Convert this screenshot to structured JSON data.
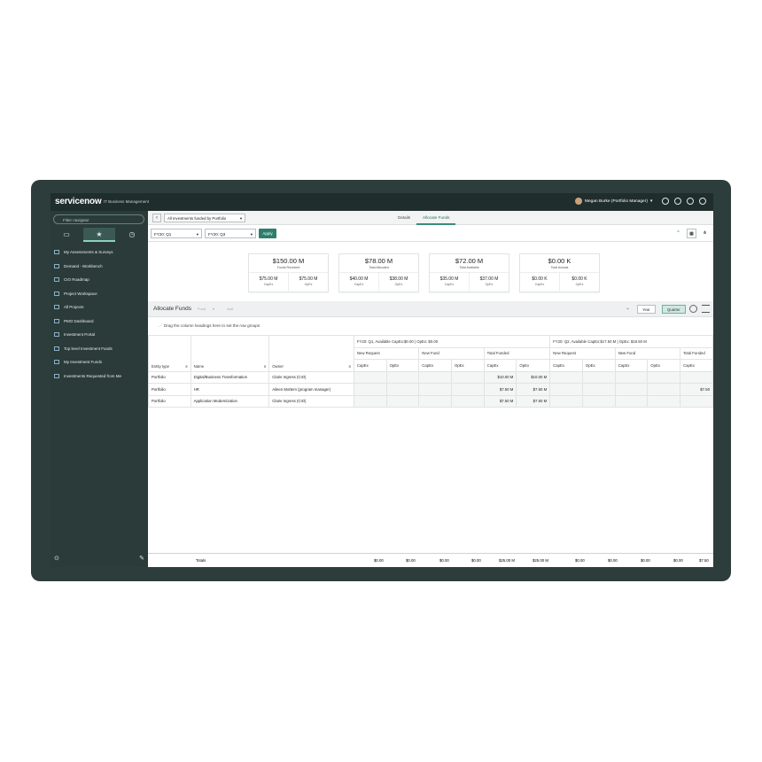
{
  "app": {
    "logo": "servicenow",
    "logo_sub": "IT Business Management",
    "user": "Megan Burke (Portfolio Manager)"
  },
  "sidebar": {
    "filter_placeholder": "Filter navigator",
    "items": [
      {
        "label": "My Assessments & Surveys"
      },
      {
        "label": "Demand - Workbench"
      },
      {
        "label": "CIO Roadmap"
      },
      {
        "label": "Project Workspace"
      },
      {
        "label": "All Projects"
      },
      {
        "label": "PMO Dashboard"
      },
      {
        "label": "Investment Portal"
      },
      {
        "label": "Top level Investment Funds"
      },
      {
        "label": "My Investment Funds"
      },
      {
        "label": "Investments Requested from Me"
      }
    ]
  },
  "header": {
    "portfolio_select": "All Investments funded by Portfolio",
    "tabs": [
      "Details",
      "Allocate Funds"
    ]
  },
  "filters": {
    "from": "FY20: Q1",
    "to": "FY20: Q3",
    "apply": "Apply"
  },
  "cards": [
    {
      "value": "$150.00 M",
      "label": "Funds Received",
      "capex": "$75.00 M",
      "opex": "$75.00 M"
    },
    {
      "value": "$78.00 M",
      "label": "Total Allocated",
      "capex": "$40.00 M",
      "opex": "$38.00 M"
    },
    {
      "value": "$72.00 M",
      "label": "Total Available",
      "capex": "$35.00 M",
      "opex": "$37.00 M"
    },
    {
      "value": "$0.00 K",
      "label": "Total Actuals",
      "capex": "$0.00 K",
      "opex": "$0.00 K"
    }
  ],
  "card_sub_labels": {
    "capex": "CapEx",
    "opex": "OpEx"
  },
  "allocate": {
    "title": "Allocate Funds",
    "fund_btn": "Fund",
    "add_btn": "Add",
    "year": "Year",
    "quarter": "Quarter",
    "group_hint": "Drag the column headings here to set the row groups"
  },
  "grid": {
    "q1_header": "FY20: Q1, Available CapEx:$0.00 | OpEx: $0.00",
    "q2_header": "FY20: Q2, Available CapEx:$17.50 M | OpEx: $18.50 M",
    "groups": [
      "New Request",
      "New Fund",
      "Total Funded"
    ],
    "col_entity": "Entity type",
    "col_name": "Name",
    "col_owner": "Owner",
    "capex": "CapEx",
    "opex": "OpEx",
    "rows": [
      {
        "entity": "Portfolio",
        "name": "Digital/Business Transformation",
        "owner": "Claire Ingress (CIO)",
        "tf_capex": "$10.00 M",
        "tf_opex": "$10.00 M",
        "q2_tf_capex": ""
      },
      {
        "entity": "Portfolio",
        "name": "HR",
        "owner": "Aileen Mottern (program manager)",
        "tf_capex": "$7.50 M",
        "tf_opex": "$7.50 M",
        "q2_tf_capex": "$7.50"
      },
      {
        "entity": "Portfolio",
        "name": "Application Modernization",
        "owner": "Claire Ingress (CIO)",
        "tf_capex": "$7.50 M",
        "tf_opex": "$7.50 M",
        "q2_tf_capex": ""
      }
    ],
    "totals_label": "Totals",
    "totals": [
      "$0.00",
      "$0.00",
      "$0.00",
      "$0.00",
      "$25.00 M",
      "$25.00 M",
      "$0.00",
      "$0.00",
      "$0.00",
      "$0.00",
      "$7.50"
    ]
  }
}
